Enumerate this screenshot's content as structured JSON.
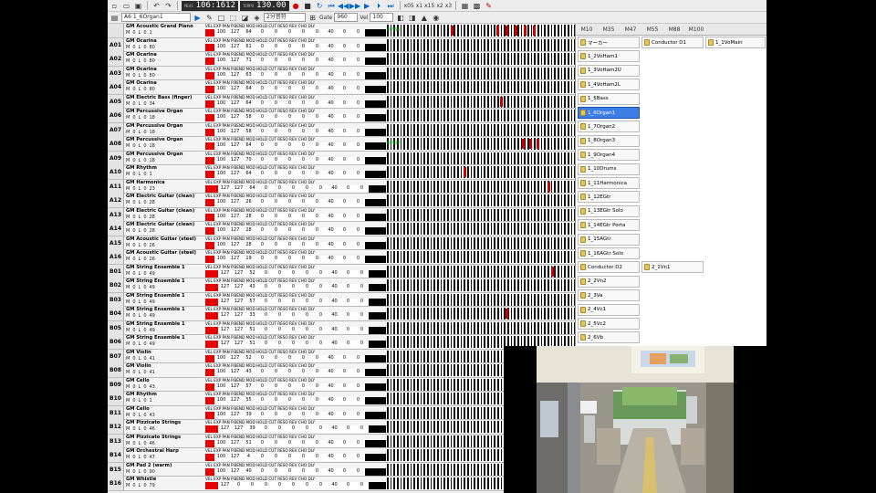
{
  "toolbar1": {
    "meas_label": "MEAS",
    "position": "106:1612",
    "tempo_label": "TEMPO",
    "tempo": "130.00",
    "zoom_options": [
      "x05",
      "x1",
      "x15",
      "x2",
      "x3"
    ]
  },
  "toolbar2": {
    "track_select": "A6 1_6Organ1",
    "split": "2分音符",
    "gate_label": "Gate",
    "gate": "960",
    "vel_label": "Vel",
    "vel": "100"
  },
  "ctl_labels": "VEL  EXP  PAN  P.BEND  MOD  HOLD  CUT  RESO  REV  CHO  DLY",
  "tracks": [
    {
      "id": "",
      "name": "GM Acoustic Grand Piano",
      "m": "M",
      "ch": "0",
      "l": "L",
      "v": "0",
      "pc": "1",
      "vals": [
        "100",
        "127",
        "64",
        "0",
        "0",
        "0",
        "0",
        "0",
        "40",
        "0",
        "0"
      ],
      "events": [
        {
          "at": 35
        },
        {
          "at": 60
        },
        {
          "at": 65
        },
        {
          "at": 70
        },
        {
          "at": 75
        },
        {
          "at": 80
        }
      ],
      "gate": true
    },
    {
      "id": "A01",
      "name": "GM Ocarina",
      "m": "M",
      "ch": "0",
      "l": "L",
      "v": "0",
      "pc": "80",
      "vals": [
        "100",
        "127",
        "61",
        "0",
        "0",
        "0",
        "0",
        "0",
        "40",
        "0",
        "0"
      ],
      "events": []
    },
    {
      "id": "A02",
      "name": "GM Ocarina",
      "m": "M",
      "ch": "0",
      "l": "L",
      "v": "0",
      "pc": "80",
      "vals": [
        "100",
        "127",
        "71",
        "0",
        "0",
        "0",
        "0",
        "0",
        "40",
        "0",
        "0"
      ],
      "events": []
    },
    {
      "id": "A03",
      "name": "GM Ocarina",
      "m": "M",
      "ch": "0",
      "l": "L",
      "v": "0",
      "pc": "80",
      "vals": [
        "100",
        "127",
        "63",
        "0",
        "0",
        "0",
        "0",
        "0",
        "40",
        "0",
        "0"
      ],
      "events": []
    },
    {
      "id": "A04",
      "name": "GM Ocarina",
      "m": "M",
      "ch": "0",
      "l": "L",
      "v": "0",
      "pc": "80",
      "vals": [
        "100",
        "127",
        "64",
        "0",
        "0",
        "0",
        "0",
        "0",
        "40",
        "0",
        "0"
      ],
      "events": []
    },
    {
      "id": "A05",
      "name": "GM Electric Bass (finger)",
      "m": "M",
      "ch": "0",
      "l": "L",
      "v": "0",
      "pc": "34",
      "vals": [
        "100",
        "127",
        "64",
        "0",
        "0",
        "0",
        "0",
        "0",
        "40",
        "0",
        "0"
      ],
      "events": [
        {
          "at": 62
        }
      ]
    },
    {
      "id": "A06",
      "name": "GM Percussive Organ",
      "m": "M",
      "ch": "0",
      "l": "L",
      "v": "0",
      "pc": "18",
      "vals": [
        "100",
        "127",
        "58",
        "0",
        "0",
        "0",
        "0",
        "0",
        "40",
        "0",
        "0"
      ],
      "events": []
    },
    {
      "id": "A07",
      "name": "GM Percussive Organ",
      "m": "M",
      "ch": "0",
      "l": "L",
      "v": "0",
      "pc": "18",
      "vals": [
        "100",
        "127",
        "58",
        "0",
        "0",
        "0",
        "0",
        "0",
        "40",
        "0",
        "0"
      ],
      "events": []
    },
    {
      "id": "A08",
      "name": "GM Percussive Organ",
      "m": "M",
      "ch": "0",
      "l": "L",
      "v": "0",
      "pc": "18",
      "vals": [
        "100",
        "127",
        "64",
        "0",
        "0",
        "0",
        "0",
        "0",
        "40",
        "0",
        "0"
      ],
      "events": [
        {
          "at": 74
        },
        {
          "at": 78
        },
        {
          "at": 82
        }
      ],
      "gate": true
    },
    {
      "id": "A09",
      "name": "GM Percussive Organ",
      "m": "M",
      "ch": "0",
      "l": "L",
      "v": "0",
      "pc": "18",
      "vals": [
        "100",
        "127",
        "70",
        "0",
        "0",
        "0",
        "0",
        "0",
        "40",
        "0",
        "0"
      ],
      "events": []
    },
    {
      "id": "A10",
      "name": "GM Rhythm",
      "m": "M",
      "ch": "0",
      "l": "L",
      "v": "0",
      "pc": "1",
      "vals": [
        "100",
        "127",
        "64",
        "0",
        "0",
        "0",
        "0",
        "0",
        "40",
        "0",
        "0"
      ],
      "events": [
        {
          "at": 42
        }
      ]
    },
    {
      "id": "A11",
      "name": "GM Harmonica",
      "m": "M",
      "ch": "0",
      "l": "L",
      "v": "0",
      "pc": "23",
      "vals": [
        "127",
        "127",
        "64",
        "0",
        "0",
        "0",
        "0",
        "0",
        "40",
        "0",
        "0"
      ],
      "events": [
        {
          "at": 88
        }
      ]
    },
    {
      "id": "A12",
      "name": "GM Electric Guitar (clean)",
      "m": "M",
      "ch": "0",
      "l": "L",
      "v": "0",
      "pc": "28",
      "vals": [
        "100",
        "127",
        "26",
        "0",
        "0",
        "0",
        "0",
        "0",
        "40",
        "0",
        "0"
      ],
      "events": []
    },
    {
      "id": "A13",
      "name": "GM Electric Guitar (clean)",
      "m": "M",
      "ch": "0",
      "l": "L",
      "v": "0",
      "pc": "28",
      "vals": [
        "100",
        "127",
        "28",
        "0",
        "0",
        "0",
        "0",
        "0",
        "40",
        "0",
        "0"
      ],
      "events": []
    },
    {
      "id": "A14",
      "name": "GM Electric Guitar (clean)",
      "m": "M",
      "ch": "0",
      "l": "L",
      "v": "0",
      "pc": "28",
      "vals": [
        "100",
        "127",
        "28",
        "0",
        "0",
        "0",
        "0",
        "0",
        "40",
        "0",
        "0"
      ],
      "events": []
    },
    {
      "id": "A15",
      "name": "GM Acoustic Guitar (steel)",
      "m": "M",
      "ch": "0",
      "l": "L",
      "v": "0",
      "pc": "26",
      "vals": [
        "100",
        "127",
        "28",
        "0",
        "0",
        "0",
        "0",
        "0",
        "40",
        "0",
        "0"
      ],
      "events": []
    },
    {
      "id": "A16",
      "name": "GM Acoustic Guitar (steel)",
      "m": "M",
      "ch": "0",
      "l": "L",
      "v": "0",
      "pc": "26",
      "vals": [
        "100",
        "127",
        "19",
        "0",
        "0",
        "0",
        "0",
        "0",
        "40",
        "0",
        "0"
      ],
      "events": []
    },
    {
      "id": "B01",
      "name": "GM String Ensemble 1",
      "m": "M",
      "ch": "0",
      "l": "L",
      "v": "0",
      "pc": "49",
      "vals": [
        "127",
        "127",
        "52",
        "0",
        "0",
        "0",
        "0",
        "0",
        "40",
        "0",
        "0"
      ],
      "events": [
        {
          "at": 90
        }
      ]
    },
    {
      "id": "B02",
      "name": "GM String Ensemble 1",
      "m": "M",
      "ch": "0",
      "l": "L",
      "v": "0",
      "pc": "49",
      "vals": [
        "127",
        "127",
        "43",
        "0",
        "0",
        "0",
        "0",
        "0",
        "40",
        "0",
        "0"
      ],
      "events": []
    },
    {
      "id": "B03",
      "name": "GM String Ensemble 1",
      "m": "M",
      "ch": "0",
      "l": "L",
      "v": "0",
      "pc": "49",
      "vals": [
        "127",
        "127",
        "57",
        "0",
        "0",
        "0",
        "0",
        "0",
        "40",
        "0",
        "0"
      ],
      "events": []
    },
    {
      "id": "B04",
      "name": "GM String Ensemble 1",
      "m": "M",
      "ch": "0",
      "l": "L",
      "v": "0",
      "pc": "49",
      "vals": [
        "127",
        "127",
        "33",
        "0",
        "0",
        "0",
        "0",
        "0",
        "40",
        "0",
        "0"
      ],
      "events": [
        {
          "at": 65
        }
      ]
    },
    {
      "id": "B05",
      "name": "GM String Ensemble 1",
      "m": "M",
      "ch": "0",
      "l": "L",
      "v": "0",
      "pc": "49",
      "vals": [
        "127",
        "127",
        "51",
        "0",
        "0",
        "0",
        "0",
        "0",
        "40",
        "0",
        "0"
      ],
      "events": []
    },
    {
      "id": "B06",
      "name": "GM String Ensemble 1",
      "m": "M",
      "ch": "0",
      "l": "L",
      "v": "0",
      "pc": "49",
      "vals": [
        "127",
        "127",
        "51",
        "0",
        "0",
        "0",
        "0",
        "0",
        "40",
        "0",
        "0"
      ],
      "events": []
    },
    {
      "id": "B07",
      "name": "GM Violin",
      "m": "M",
      "ch": "0",
      "l": "L",
      "v": "0",
      "pc": "41",
      "vals": [
        "100",
        "127",
        "52",
        "0",
        "0",
        "0",
        "0",
        "0",
        "40",
        "0",
        "0"
      ],
      "events": []
    },
    {
      "id": "B08",
      "name": "GM Violin",
      "m": "M",
      "ch": "0",
      "l": "L",
      "v": "0",
      "pc": "41",
      "vals": [
        "100",
        "127",
        "43",
        "0",
        "0",
        "0",
        "0",
        "0",
        "40",
        "0",
        "0"
      ],
      "events": []
    },
    {
      "id": "B09",
      "name": "GM Cello",
      "m": "M",
      "ch": "0",
      "l": "L",
      "v": "0",
      "pc": "43",
      "vals": [
        "100",
        "127",
        "57",
        "0",
        "0",
        "0",
        "0",
        "0",
        "40",
        "0",
        "0"
      ],
      "events": []
    },
    {
      "id": "B10",
      "name": "GM Rhythm",
      "m": "M",
      "ch": "0",
      "l": "L",
      "v": "0",
      "pc": "1",
      "vals": [
        "100",
        "127",
        "55",
        "0",
        "0",
        "0",
        "0",
        "0",
        "40",
        "0",
        "0"
      ],
      "events": []
    },
    {
      "id": "B11",
      "name": "GM Cello",
      "m": "M",
      "ch": "0",
      "l": "L",
      "v": "0",
      "pc": "43",
      "vals": [
        "100",
        "127",
        "39",
        "0",
        "0",
        "0",
        "0",
        "0",
        "40",
        "0",
        "0"
      ],
      "events": []
    },
    {
      "id": "B12",
      "name": "GM Pizzicato Strings",
      "m": "M",
      "ch": "0",
      "l": "L",
      "v": "0",
      "pc": "46",
      "vals": [
        "127",
        "127",
        "39",
        "0",
        "0",
        "0",
        "0",
        "0",
        "40",
        "0",
        "0"
      ],
      "events": []
    },
    {
      "id": "B13",
      "name": "GM Pizzicato Strings",
      "m": "M",
      "ch": "0",
      "l": "L",
      "v": "0",
      "pc": "46",
      "vals": [
        "100",
        "127",
        "51",
        "0",
        "0",
        "0",
        "0",
        "0",
        "40",
        "0",
        "0"
      ],
      "events": []
    },
    {
      "id": "B14",
      "name": "GM Orchestral Harp",
      "m": "M",
      "ch": "0",
      "l": "L",
      "v": "0",
      "pc": "47",
      "vals": [
        "100",
        "127",
        "4",
        "0",
        "0",
        "0",
        "0",
        "0",
        "40",
        "0",
        "0"
      ],
      "events": []
    },
    {
      "id": "B15",
      "name": "GM Pad 2 (warm)",
      "m": "M",
      "ch": "0",
      "l": "L",
      "v": "0",
      "pc": "90",
      "vals": [
        "100",
        "127",
        "40",
        "0",
        "0",
        "0",
        "0",
        "0",
        "40",
        "0",
        "0"
      ],
      "events": []
    },
    {
      "id": "B16",
      "name": "GM Whistle",
      "m": "M",
      "ch": "0",
      "l": "L",
      "v": "0",
      "pc": "79",
      "vals": [
        "127",
        "0",
        "0",
        "0",
        "0",
        "0",
        "0",
        "0",
        "40",
        "0",
        "0"
      ],
      "events": []
    }
  ],
  "panel": {
    "header": [
      "M10",
      "M35",
      "M47",
      "M55",
      "M88",
      "M100"
    ],
    "col1": [
      {
        "label": "マーカー"
      },
      {
        "label": "1_2VoHam1"
      },
      {
        "label": "1_3VoHam2U"
      },
      {
        "label": "1_4VoHam2L"
      },
      {
        "label": "1_5Bass"
      },
      {
        "label": "1_6Organ1",
        "selected": true
      },
      {
        "label": "1_7Organ2"
      },
      {
        "label": "1_8Organ3"
      },
      {
        "label": "1_9Organ4"
      },
      {
        "label": "1_10Drums"
      },
      {
        "label": "1_11Harmonica"
      },
      {
        "label": "1_12EGtr"
      },
      {
        "label": "1_13EGtr Solo"
      },
      {
        "label": "1_14EGtr Porta"
      },
      {
        "label": "1_15AGtr"
      },
      {
        "label": "1_16AGtr Solo"
      },
      {
        "label": "Conductor D2"
      },
      {
        "label": "2_2Vn2"
      },
      {
        "label": "2_3Va"
      },
      {
        "label": "2_4Vc1"
      },
      {
        "label": "2_5Vc2"
      },
      {
        "label": "2_6Vb"
      }
    ],
    "col2": [
      {
        "label": "Conductor D1",
        "row": 0
      },
      {
        "label": "2_1Vn1",
        "row": 16
      }
    ],
    "col3": [
      {
        "label": "1_1VoMain",
        "row": 0
      }
    ]
  },
  "colors": {
    "red": "#e80000",
    "black": "#000000",
    "selected": "#3c7ee6",
    "folder": "#e7c35a"
  }
}
